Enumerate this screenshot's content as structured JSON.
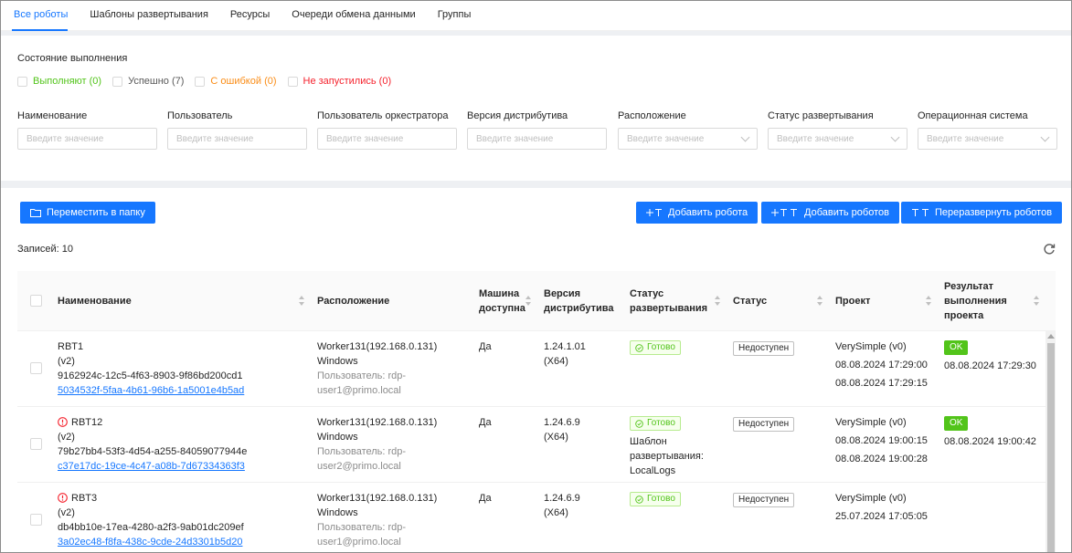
{
  "tabs": [
    "Все роботы",
    "Шаблоны развертывания",
    "Ресурсы",
    "Очереди обмена данными",
    "Группы"
  ],
  "filters": {
    "state_title": "Состояние выполнения",
    "states": [
      {
        "label": "Выполняют (0)"
      },
      {
        "label": "Успешно (7)"
      },
      {
        "label": "С ошибкой (0)"
      },
      {
        "label": "Не запустились (0)"
      }
    ],
    "fields": [
      {
        "label": "Наименование",
        "placeholder": "Введите значение"
      },
      {
        "label": "Пользователь",
        "placeholder": "Введите значение"
      },
      {
        "label": "Пользователь оркестратора",
        "placeholder": "Введите значение"
      },
      {
        "label": "Версия дистрибутива",
        "placeholder": "Введите значение"
      },
      {
        "label": "Расположение",
        "placeholder": "Введите значение"
      },
      {
        "label": "Статус развертывания",
        "placeholder": "Введите значение"
      },
      {
        "label": "Операционная система",
        "placeholder": "Введите значение"
      }
    ]
  },
  "toolbar": {
    "move_label": "Переместить в папку",
    "add_robot_label": "Добавить робота",
    "add_robots_label": "Добавить роботов",
    "redeploy_label": "Переразвернуть роботов"
  },
  "records_label": "Записей: 10",
  "table": {
    "headers": {
      "name": "Наименование",
      "location": "Расположение",
      "machine1": "Машина",
      "machine2": "доступна",
      "version1": "Версия",
      "version2": "дистрибутива",
      "deploy1": "Статус",
      "deploy2": "развертывания",
      "status": "Статус",
      "project": "Проект",
      "result1": "Результат",
      "result2": "выполнения",
      "result3": "проекта"
    },
    "rows": [
      {
        "name": "RBT1",
        "ver_tag": "(v2)",
        "guid": "9162924c-12c5-4f63-8903-9f86bd200cd1",
        "link": "5034532f-5faa-4b61-96b6-1a5001e4b5ad",
        "loc1": "Worker131(192.168.0.131)",
        "loc2": "Windows",
        "loc3": "Пользователь: rdp-",
        "loc4": "user1@primo.local",
        "machine": "Да",
        "dist1": "1.24.1.01",
        "dist2": "(X64)",
        "deploy": "Готово",
        "status": "Недоступен",
        "proj1": "VerySimple (v0)",
        "proj2": "08.08.2024 17:29:00",
        "proj3": "08.08.2024 17:29:15",
        "result_tag": "OK",
        "result_time": "08.08.2024 17:29:30"
      },
      {
        "name": "RBT12",
        "ver_tag": "(v2)",
        "guid": "79b27bb4-53f3-4d54-a255-84059077944e",
        "link": "c37e17dc-19ce-4c47-a08b-7d67334363f3",
        "loc1": "Worker131(192.168.0.131)",
        "loc2": "Windows",
        "loc3": "Пользователь: rdp-",
        "loc4": "user2@primo.local",
        "machine": "Да",
        "dist1": "1.24.6.9",
        "dist2": "(X64)",
        "deploy": "Готово",
        "deploy_extra1": "Шаблон",
        "deploy_extra2": "развертывания:",
        "deploy_extra3": "LocalLogs",
        "status": "Недоступен",
        "proj1": "VerySimple (v0)",
        "proj2": "08.08.2024 19:00:15",
        "proj3": "08.08.2024 19:00:28",
        "result_tag": "OK",
        "result_time": "08.08.2024 19:00:42"
      },
      {
        "name": "RBT3",
        "ver_tag": "(v2)",
        "guid": "db4bb10e-17ea-4280-a2f3-9ab01dc209ef",
        "link": "3a02ec48-f8fa-438c-9cde-24d3301b5d20",
        "loc1": "Worker131(192.168.0.131)",
        "loc2": "Windows",
        "loc3": "Пользователь: rdp-",
        "loc4": "user1@primo.local",
        "machine": "Да",
        "dist1": "1.24.6.9",
        "dist2": "(X64)",
        "deploy": "Готово",
        "status": "Недоступен",
        "proj1": "VerySimple (v0)",
        "proj2": "25.07.2024 17:05:05"
      }
    ]
  },
  "colors": {
    "primary": "#1677ff",
    "success": "#52c41a",
    "warning": "#fa8c16",
    "error": "#f5222d"
  }
}
